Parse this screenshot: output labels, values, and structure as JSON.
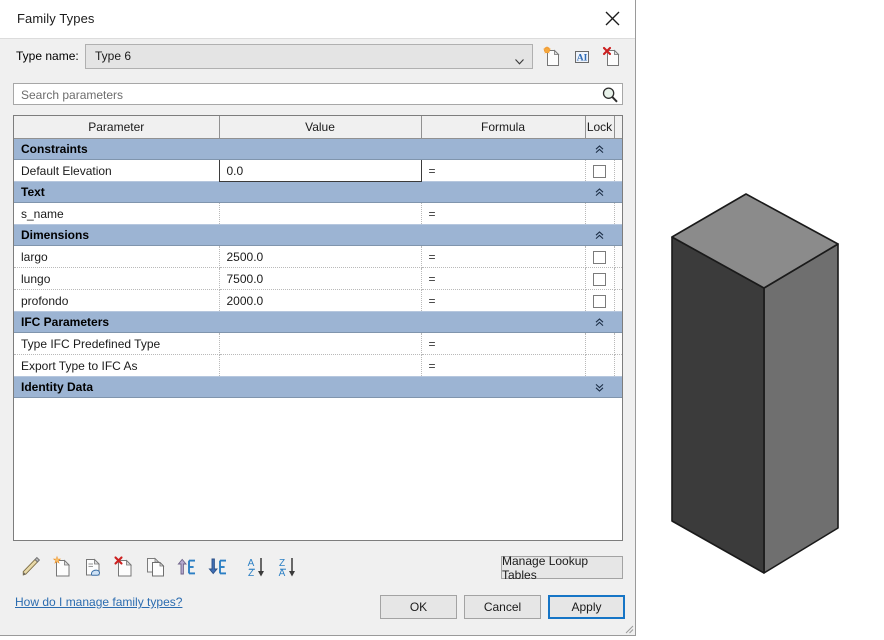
{
  "window": {
    "title": "Family Types",
    "close_icon": "close-icon"
  },
  "type_name": {
    "label": "Type name:",
    "value": "Type 6",
    "dropdown_icon": "chevron-down-icon",
    "actions": [
      {
        "name": "new-type-icon",
        "tooltip": "New Type"
      },
      {
        "name": "rename-type-icon",
        "tooltip": "Rename"
      },
      {
        "name": "delete-type-icon",
        "tooltip": "Delete"
      }
    ]
  },
  "search": {
    "placeholder": "Search parameters",
    "value": "",
    "icon": "search-icon"
  },
  "table": {
    "columns": [
      "Parameter",
      "Value",
      "Formula",
      "Lock"
    ],
    "groups": [
      {
        "name": "Constraints",
        "collapsed": false,
        "chevron": "chevron-double-up-icon",
        "rows": [
          {
            "parameter": "Default Elevation",
            "value": "0.0",
            "formula": "=",
            "lock": true,
            "focused": true
          }
        ]
      },
      {
        "name": "Text",
        "collapsed": false,
        "chevron": "chevron-double-up-icon",
        "rows": [
          {
            "parameter": "s_name",
            "value": "",
            "formula": "=",
            "lock": false,
            "focused": false
          }
        ]
      },
      {
        "name": "Dimensions",
        "collapsed": false,
        "chevron": "chevron-double-up-icon",
        "rows": [
          {
            "parameter": "largo",
            "value": "2500.0",
            "formula": "=",
            "lock": true,
            "focused": false
          },
          {
            "parameter": "lungo",
            "value": "7500.0",
            "formula": "=",
            "lock": true,
            "focused": false
          },
          {
            "parameter": "profondo",
            "value": "2000.0",
            "formula": "=",
            "lock": true,
            "focused": false
          }
        ]
      },
      {
        "name": "IFC Parameters",
        "collapsed": false,
        "chevron": "chevron-double-up-icon",
        "rows": [
          {
            "parameter": "Type IFC Predefined Type",
            "value": "",
            "formula": "=",
            "lock": false,
            "focused": false
          },
          {
            "parameter": "Export Type to IFC As",
            "value": "",
            "formula": "=",
            "lock": false,
            "focused": false
          }
        ]
      },
      {
        "name": "Identity Data",
        "collapsed": true,
        "chevron": "chevron-double-down-icon",
        "rows": []
      }
    ]
  },
  "toolbar": {
    "icons": [
      {
        "name": "edit-parameter-icon",
        "tooltip": "Edit Parameter"
      },
      {
        "name": "new-parameter-icon",
        "tooltip": "New Parameter"
      },
      {
        "name": "new-global-parameter-icon",
        "tooltip": "New Global Parameter"
      },
      {
        "name": "delete-parameter-icon",
        "tooltip": "Remove Parameter"
      },
      {
        "name": "duplicate-parameter-icon",
        "tooltip": "Duplicate"
      },
      {
        "name": "move-up-icon",
        "tooltip": "Move Up"
      },
      {
        "name": "move-down-icon",
        "tooltip": "Move Down"
      },
      {
        "name": "sort-ascending-icon",
        "tooltip": "Sort Ascending"
      },
      {
        "name": "sort-descending-icon",
        "tooltip": "Sort Descending"
      }
    ],
    "manage_lookup_label": "Manage Lookup Tables"
  },
  "footer": {
    "help_link": "How do I manage family types?",
    "ok_label": "OK",
    "cancel_label": "Cancel",
    "apply_label": "Apply",
    "apply_focused": true
  },
  "viewport": {
    "model": "extruded-rectangular-box",
    "faces": {
      "top": "#8b8b8b",
      "left": "#3b3b3b",
      "right": "#6f6f6f"
    },
    "outline": "#1a1a1a"
  },
  "colors": {
    "group_header": "#9cb4d3",
    "dialog_bg": "#f0f0f0",
    "focus_blue": "#1675c6",
    "link_blue": "#2b6cb0"
  }
}
